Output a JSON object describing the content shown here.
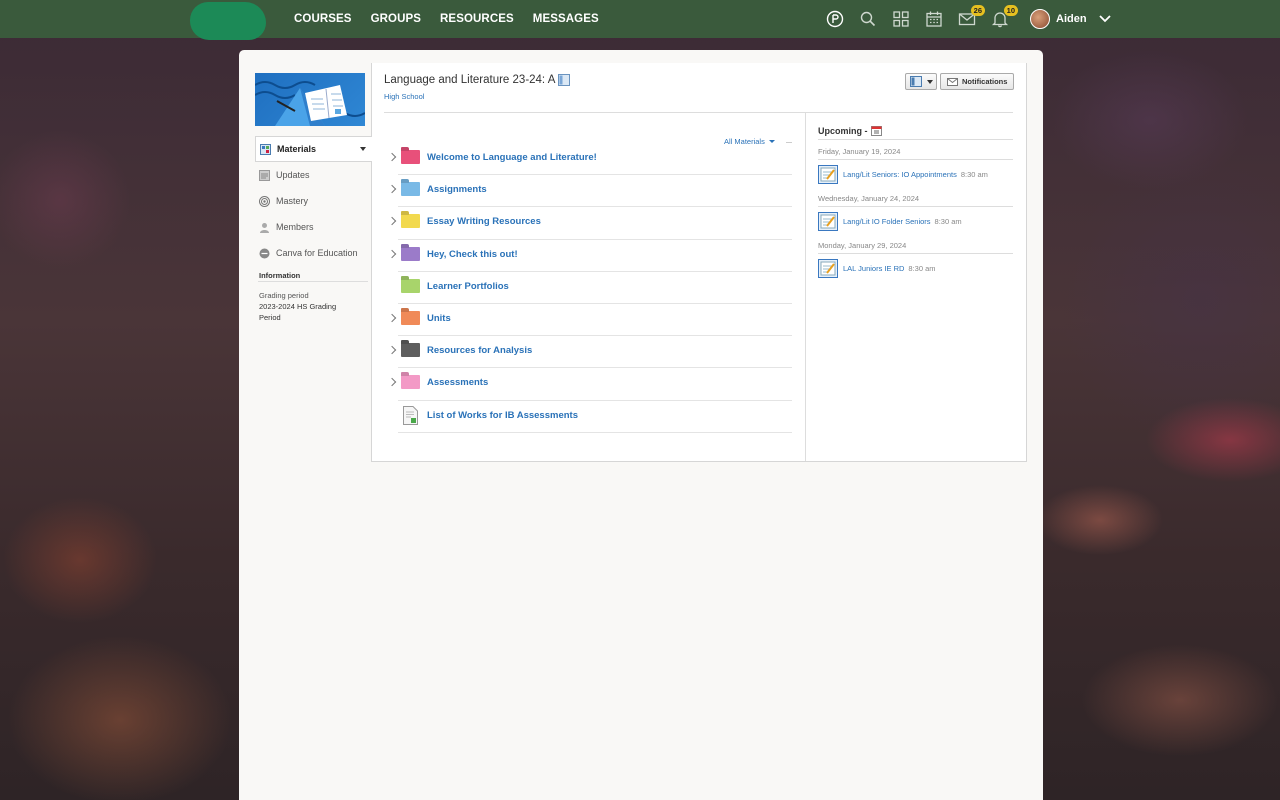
{
  "nav": {
    "links": [
      "COURSES",
      "GROUPS",
      "RESOURCES",
      "MESSAGES"
    ],
    "messages_badge": "26",
    "notifications_badge": "10",
    "user_name": "Aiden",
    "icons": [
      "sign-in-icon",
      "search-icon",
      "apps-grid-icon",
      "calendar-icon",
      "envelope-icon",
      "bell-icon"
    ]
  },
  "course": {
    "title": "Language and Literature 23-24: A",
    "subtitle": "High School",
    "notifications_button": "Notifications"
  },
  "sidebar": {
    "items": [
      {
        "label": "Materials",
        "icon": "materials-icon",
        "active": true
      },
      {
        "label": "Updates",
        "icon": "updates-icon"
      },
      {
        "label": "Mastery",
        "icon": "mastery-icon"
      },
      {
        "label": "Members",
        "icon": "members-icon"
      },
      {
        "label": "Canva for Education",
        "icon": "canva-icon"
      }
    ],
    "info_heading": "Information",
    "grading_label": "Grading period",
    "grading_value": "2023-2024 HS Grading Period"
  },
  "materials": {
    "filter_label": "All Materials",
    "items": [
      {
        "label": "Welcome to Language and Literature!",
        "color": "#e8507a",
        "expandable": true
      },
      {
        "label": "Assignments",
        "color": "#79b9e6",
        "expandable": true
      },
      {
        "label": "Essay Writing Resources",
        "color": "#f2d94e",
        "expandable": true
      },
      {
        "label": "Hey, Check this out!",
        "color": "#9b7bc9",
        "expandable": true
      },
      {
        "label": "Learner Portfolios",
        "color": "#a8d46b",
        "expandable": false
      },
      {
        "label": "Units",
        "color": "#f08a58",
        "expandable": true
      },
      {
        "label": "Resources for Analysis",
        "color": "#5e5e5e",
        "expandable": true
      },
      {
        "label": "Assessments",
        "color": "#f39ac6",
        "expandable": true
      },
      {
        "label": "List of Works for IB Assessments",
        "color": "file",
        "expandable": false
      }
    ]
  },
  "upcoming": {
    "heading": "Upcoming -",
    "groups": [
      {
        "date": "Friday, January 19, 2024",
        "event": "Lang/Lit Seniors: IO Appointments",
        "time": "8:30 am"
      },
      {
        "date": "Wednesday, January 24, 2024",
        "event": "Lang/Lit IO Folder Seniors",
        "time": "8:30 am"
      },
      {
        "date": "Monday, January 29, 2024",
        "event": "LAL Juniors IE RD",
        "time": "8:30 am"
      }
    ]
  }
}
